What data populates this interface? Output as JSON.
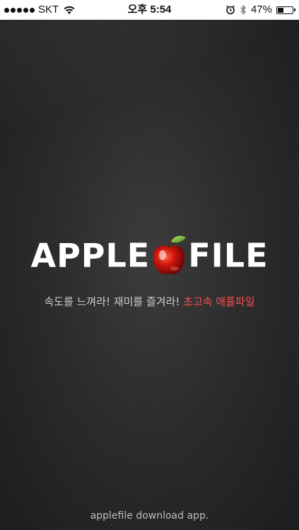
{
  "status_bar": {
    "carrier": "SKT",
    "time": "오후 5:54",
    "battery_percent": "47%",
    "battery_level": 0.47,
    "icons": [
      "signal-dots-icon",
      "wifi-icon",
      "alarm-icon",
      "bluetooth-icon",
      "battery-icon"
    ]
  },
  "splash": {
    "logo_left": "APPLE",
    "logo_right": "FILE",
    "logo_icon": "red-apple-icon",
    "tagline_main": "속도를 느껴라! 재미를 즐겨라! ",
    "tagline_accent": "초고속 애플파일",
    "footer": "applefile download app."
  },
  "colors": {
    "background": "#202020",
    "accent_red": "#ff4f4f",
    "text_white": "#ffffff"
  }
}
